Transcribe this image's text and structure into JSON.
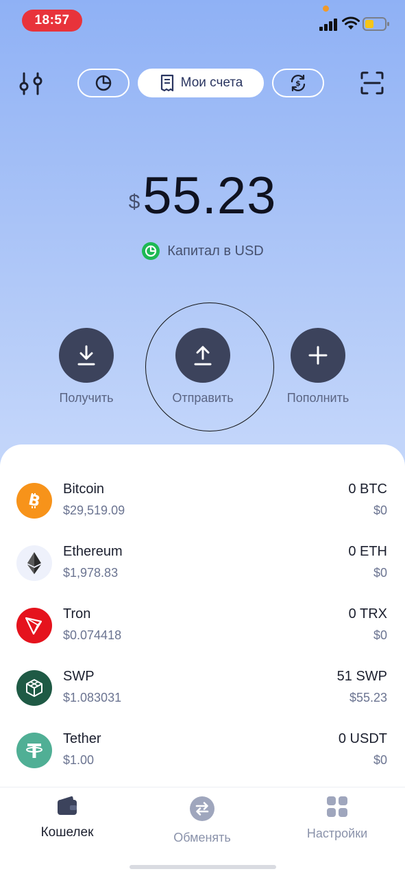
{
  "status_bar": {
    "time": "18:57"
  },
  "top_nav": {
    "accounts_label": "Мои счета"
  },
  "balance": {
    "currency_symbol": "$",
    "amount": "55.23",
    "capital_label": "Капитал в USD"
  },
  "actions": [
    {
      "label": "Получить",
      "icon": "download-icon"
    },
    {
      "label": "Отправить",
      "icon": "upload-icon"
    },
    {
      "label": "Пополнить",
      "icon": "plus-icon"
    }
  ],
  "assets": [
    {
      "name": "Bitcoin",
      "price": "$29,519.09",
      "quantity": "0 BTC",
      "value": "$0",
      "color": "#f7931a",
      "icon": "bitcoin-icon"
    },
    {
      "name": "Ethereum",
      "price": "$1,978.83",
      "quantity": "0 ETH",
      "value": "$0",
      "color": "#eef1fb",
      "icon": "ethereum-icon"
    },
    {
      "name": "Tron",
      "price": "$0.074418",
      "quantity": "0 TRX",
      "value": "$0",
      "color": "#e5131d",
      "icon": "tron-icon"
    },
    {
      "name": "SWP",
      "price": "$1.083031",
      "quantity": "51 SWP",
      "value": "$55.23",
      "color": "#1f5a45",
      "icon": "swp-icon"
    },
    {
      "name": "Tether",
      "price": "$1.00",
      "quantity": "0 USDT",
      "value": "$0",
      "color": "#50af95",
      "icon": "tether-icon"
    }
  ],
  "bottom_nav": {
    "tabs": [
      {
        "label": "Кошелек",
        "icon": "wallet-icon",
        "active": true
      },
      {
        "label": "Обменять",
        "icon": "swap-icon",
        "active": false
      },
      {
        "label": "Настройки",
        "icon": "settings-grid-icon",
        "active": false
      }
    ]
  },
  "colors": {
    "accent_dark": "#3c435c",
    "capital_green": "#1db954",
    "status_red": "#e8333b"
  }
}
